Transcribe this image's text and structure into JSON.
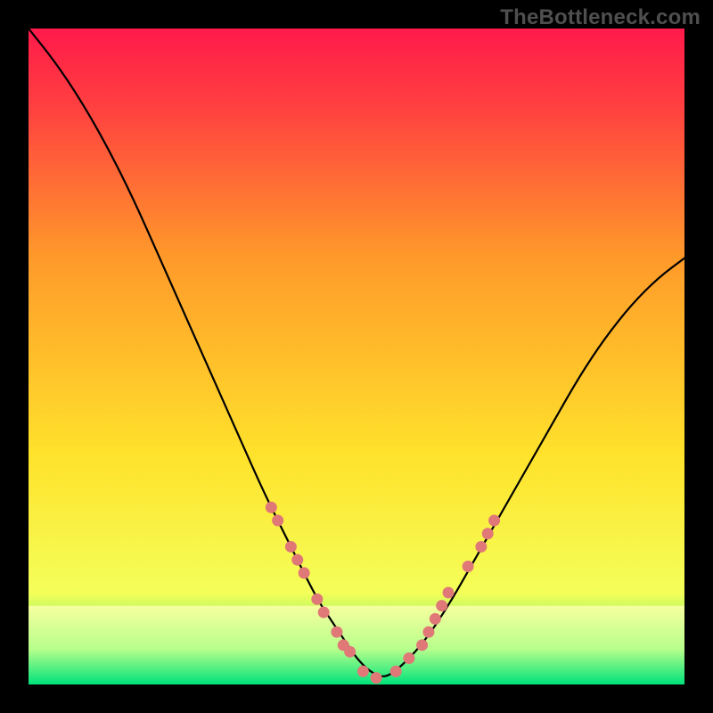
{
  "watermark": "TheBottleneck.com",
  "chart_data": {
    "type": "line",
    "title": "",
    "xlabel": "",
    "ylabel": "",
    "xlim": [
      0,
      100
    ],
    "ylim": [
      0,
      100
    ],
    "background_gradient": {
      "top": "#ff1a4b",
      "middle": "#ffe22b",
      "bottom": "#00e27a"
    },
    "series": [
      {
        "name": "curve",
        "x": [
          0,
          4,
          8,
          12,
          16,
          20,
          24,
          28,
          32,
          36,
          40,
          44,
          46,
          48,
          50,
          52,
          54,
          56,
          60,
          64,
          68,
          72,
          76,
          80,
          84,
          88,
          92,
          96,
          100
        ],
        "y": [
          100,
          95,
          89,
          82,
          74,
          65,
          56,
          47,
          38,
          29,
          21,
          13,
          10,
          7,
          4,
          2,
          1,
          2,
          6,
          12,
          19,
          26,
          33,
          40,
          47,
          53,
          58,
          62,
          65
        ]
      }
    ],
    "markers": {
      "name": "sample-points",
      "color": "#e07878",
      "points": [
        {
          "x": 37,
          "y": 27
        },
        {
          "x": 38,
          "y": 25
        },
        {
          "x": 40,
          "y": 21
        },
        {
          "x": 41,
          "y": 19
        },
        {
          "x": 42,
          "y": 17
        },
        {
          "x": 44,
          "y": 13
        },
        {
          "x": 45,
          "y": 11
        },
        {
          "x": 47,
          "y": 8
        },
        {
          "x": 48,
          "y": 6
        },
        {
          "x": 49,
          "y": 5
        },
        {
          "x": 51,
          "y": 2
        },
        {
          "x": 53,
          "y": 1
        },
        {
          "x": 56,
          "y": 2
        },
        {
          "x": 58,
          "y": 4
        },
        {
          "x": 60,
          "y": 6
        },
        {
          "x": 61,
          "y": 8
        },
        {
          "x": 62,
          "y": 10
        },
        {
          "x": 63,
          "y": 12
        },
        {
          "x": 64,
          "y": 14
        },
        {
          "x": 67,
          "y": 18
        },
        {
          "x": 69,
          "y": 21
        },
        {
          "x": 70,
          "y": 23
        },
        {
          "x": 71,
          "y": 25
        }
      ]
    },
    "bottom_band": {
      "y_from": 0,
      "y_to": 12,
      "color_top": "#f6ff9e",
      "color_bottom": "#00e27a"
    }
  }
}
